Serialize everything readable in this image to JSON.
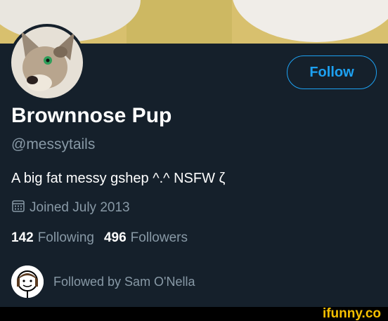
{
  "profile": {
    "display_name": "Brownnose Pup",
    "handle": "@messytails",
    "bio": "A big fat messy gshep ^.^ NSFW ζ",
    "joined": "Joined July 2013",
    "following_count": "142",
    "following_label": "Following",
    "followers_count": "496",
    "followers_label": "Followers"
  },
  "actions": {
    "follow_label": "Follow"
  },
  "followed_by": {
    "text": "Followed by Sam O'Nella"
  },
  "watermark": {
    "brand": "ifunny.co"
  },
  "colors": {
    "background": "#15202b",
    "accent": "#1da1f2",
    "muted": "#8899a6",
    "brand": "#f5c000"
  },
  "icons": {
    "calendar": "calendar-icon"
  }
}
